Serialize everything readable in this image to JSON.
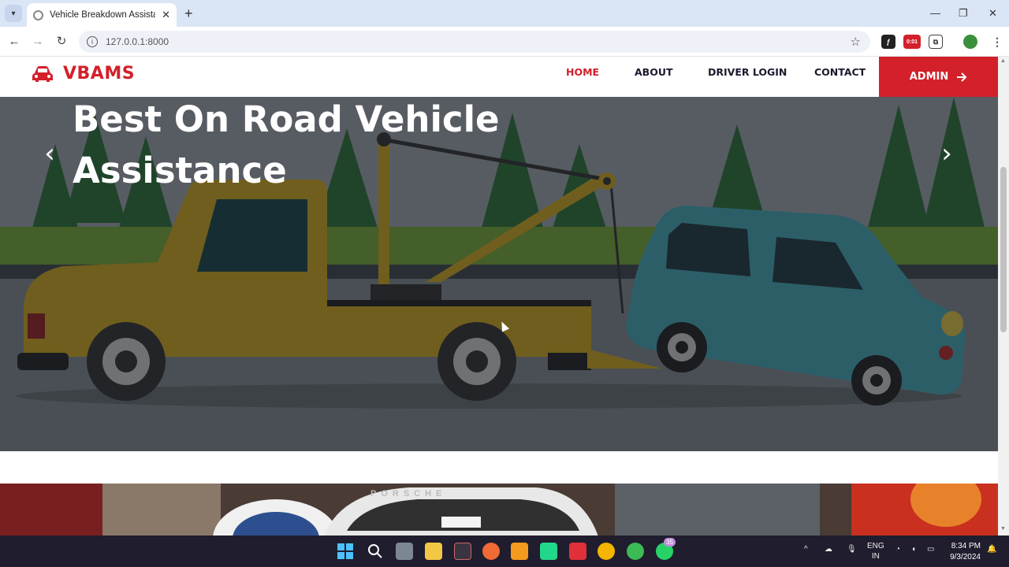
{
  "browser": {
    "tab_title": "Vehicle Breakdown Assistance M",
    "url": "127.0.0.1:8000",
    "extension_badge": "0:01"
  },
  "site": {
    "brand": "VBAMS",
    "nav": {
      "home": "HOME",
      "about": "ABOUT",
      "driver_login": "DRIVER LOGIN",
      "contact": "CONTACT",
      "admin": "ADMIN"
    },
    "hero": {
      "title": "Best On Road Vehicle Assistance",
      "prev_glyph": "‹",
      "next_glyph": "›"
    },
    "section2": {
      "car_text": "PORSCHE"
    }
  },
  "taskbar": {
    "lang_line1": "ENG",
    "lang_line2": "IN",
    "time": "8:34 PM",
    "date": "9/3/2024",
    "whatsapp_badge": "35"
  },
  "colors": {
    "brand_red": "#d3202a",
    "truck_yellow": "#e0b41f",
    "car_teal": "#4bb3c4"
  },
  "icons": [
    "car-icon",
    "arrow-right-icon",
    "chevron-left-icon",
    "chevron-right-icon",
    "back-icon",
    "forward-icon",
    "reload-icon",
    "info-icon",
    "star-icon",
    "windows-start-icon",
    "search-icon"
  ]
}
